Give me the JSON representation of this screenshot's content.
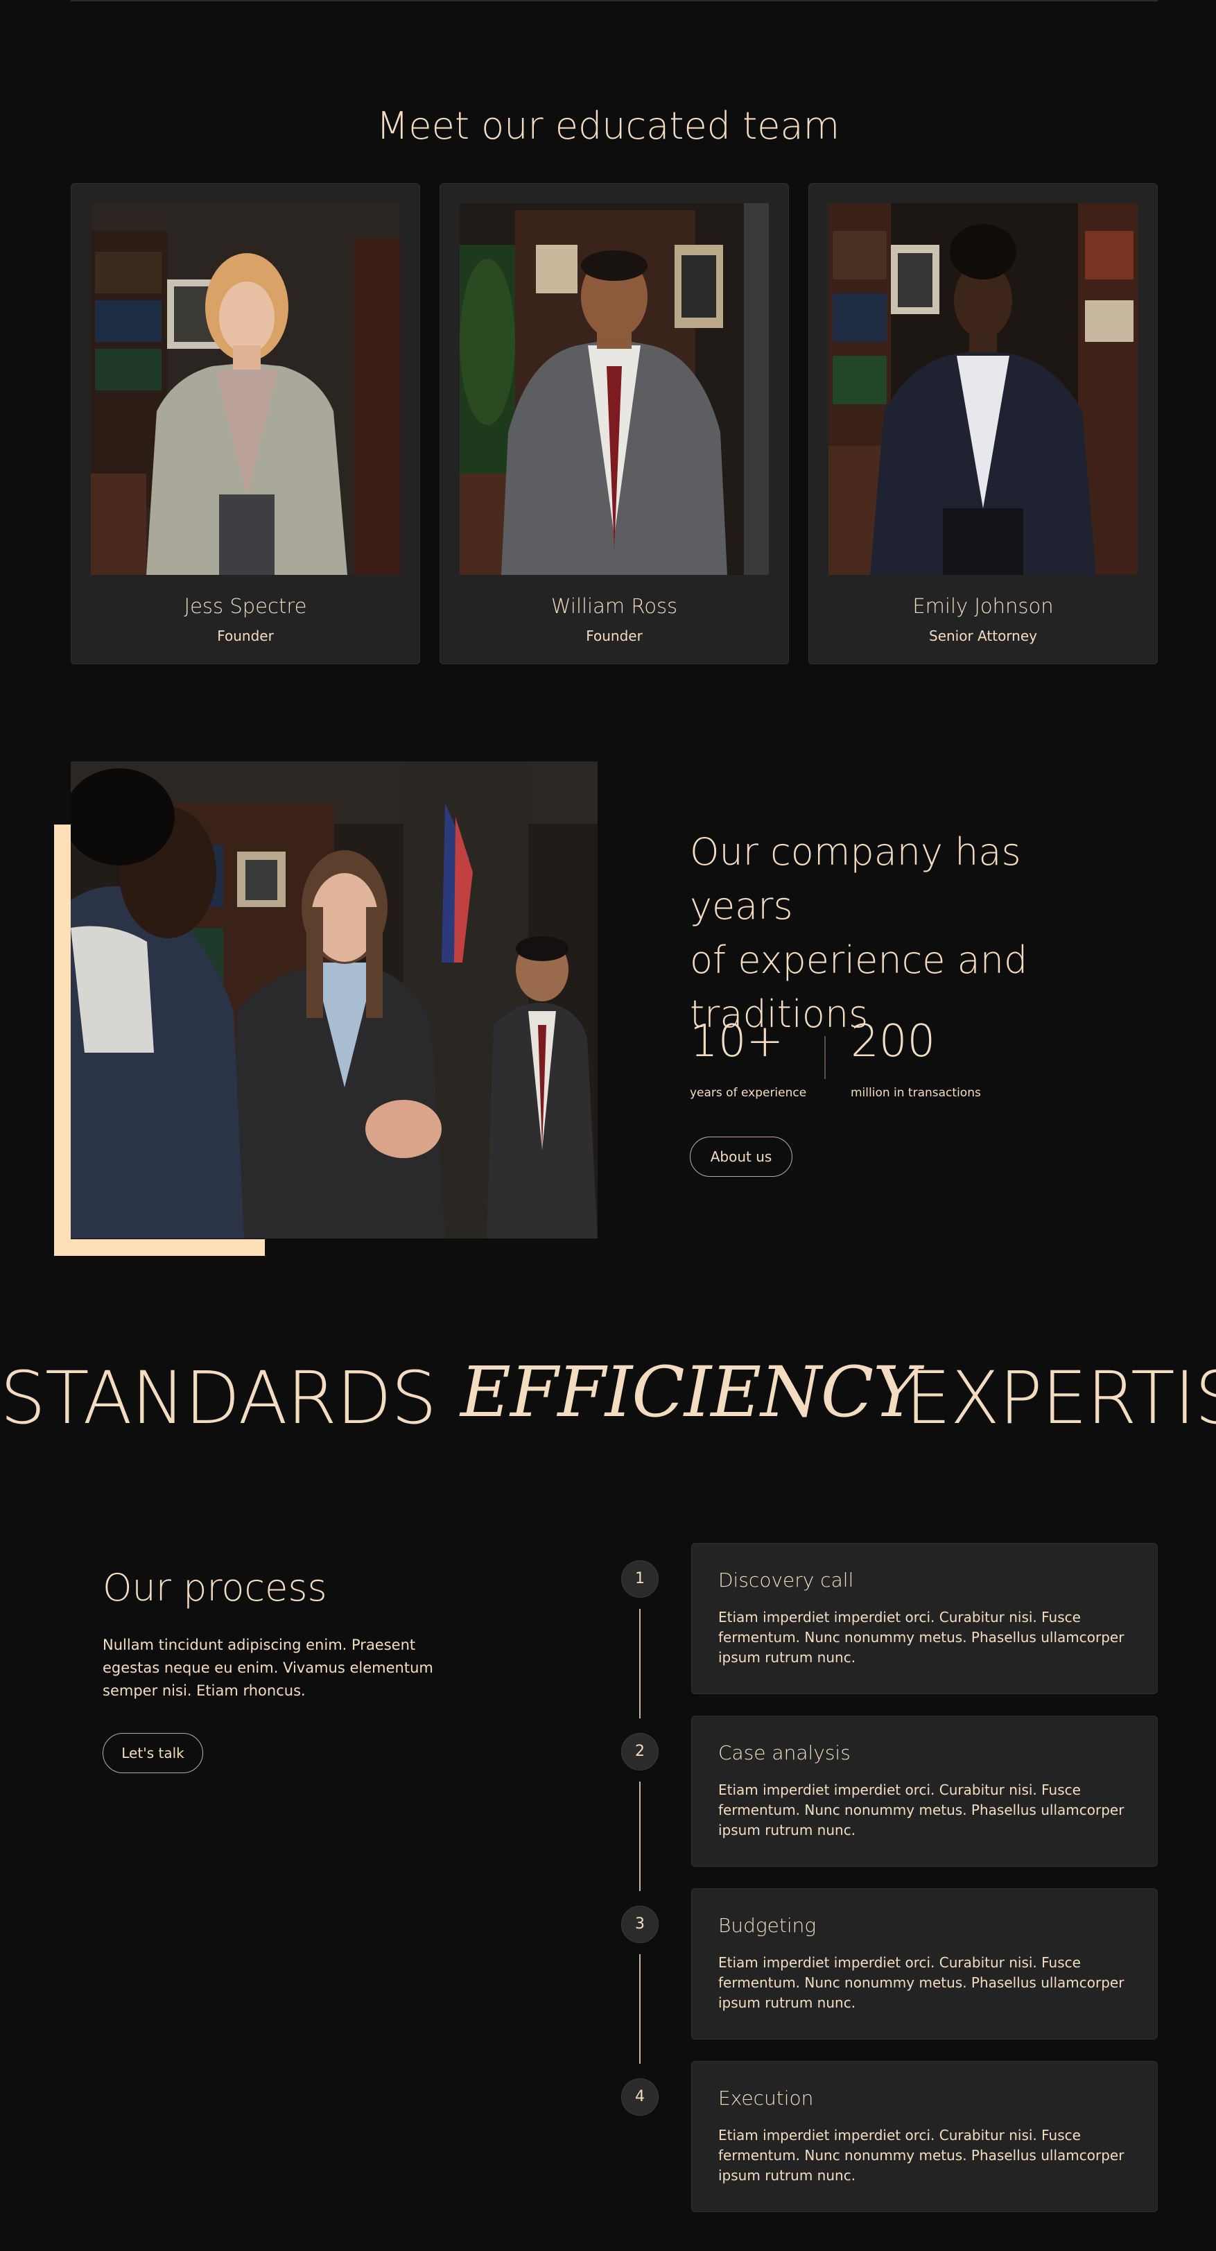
{
  "team": {
    "title": "Meet our educated team",
    "members": [
      {
        "name": "Jess Spectre",
        "role": "Founder"
      },
      {
        "name": "William Ross",
        "role": "Founder"
      },
      {
        "name": "Emily Johnson",
        "role": "Senior Attorney"
      }
    ]
  },
  "about": {
    "heading_lines": [
      "Our company has years",
      "of experience and",
      "traditions"
    ],
    "stats": [
      {
        "value": "10+",
        "label": "years of experience"
      },
      {
        "value": "200",
        "label": "million in transactions"
      }
    ],
    "button_label": "About us"
  },
  "marquee": {
    "words": [
      "STANDARDS",
      "EFFICIENCY",
      "EXPERTIS"
    ]
  },
  "process": {
    "title": "Our process",
    "description": "Nullam tincidunt adipiscing enim. Praesent egestas neque eu enim. Vivamus elementum semper nisi. Etiam rhoncus.",
    "button_label": "Let's talk",
    "steps": [
      {
        "number": "1",
        "title": "Discovery call",
        "text": "Etiam imperdiet imperdiet orci. Curabitur nisi. Fusce fermentum. Nunc nonummy metus. Phasellus ullamcorper ipsum rutrum nunc."
      },
      {
        "number": "2",
        "title": "Case analysis",
        "text": "Etiam imperdiet imperdiet orci. Curabitur nisi. Fusce fermentum. Nunc nonummy metus. Phasellus ullamcorper ipsum rutrum nunc."
      },
      {
        "number": "3",
        "title": "Budgeting",
        "text": "Etiam imperdiet imperdiet orci. Curabitur nisi. Fusce fermentum. Nunc nonummy metus. Phasellus ullamcorper ipsum rutrum nunc."
      },
      {
        "number": "4",
        "title": "Execution",
        "text": "Etiam imperdiet imperdiet orci. Curabitur nisi. Fusce fermentum. Nunc nonummy metus. Phasellus ullamcorper ipsum rutrum nunc."
      }
    ]
  },
  "colors": {
    "background": "#0d0d0d",
    "card": "#232323",
    "accent": "#ffdfb8",
    "text": "#f3dcc0"
  }
}
